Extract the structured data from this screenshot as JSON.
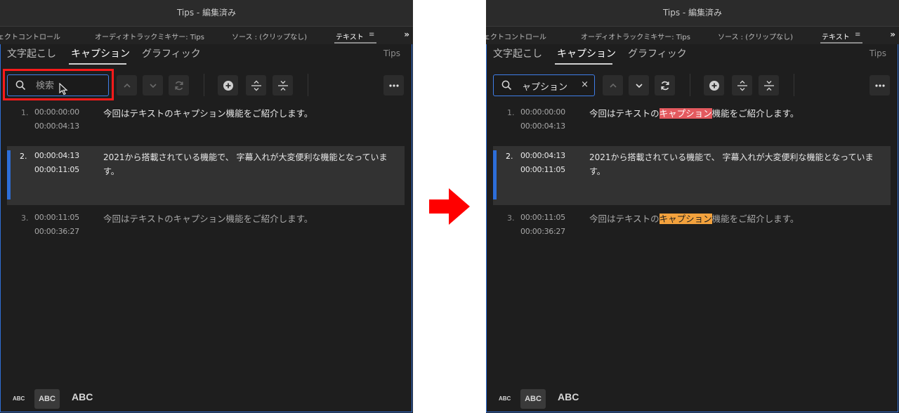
{
  "left": {
    "window_title": "Tips - 編集済み",
    "panel_tabs": {
      "effect_controls": "ェクトコントロール",
      "audio_mixer": "オーディオトラックミキサー: Tips",
      "source": "ソース : (クリップなし)",
      "text": "テキスト",
      "menu_icon": "≡",
      "more_icon": "»"
    },
    "sub_tabs": {
      "transcribe": "文字起こし",
      "captions": "キャプション",
      "graphics": "グラフィック",
      "sequence": "Tips"
    },
    "search": {
      "placeholder": "検索",
      "value": ""
    },
    "captions": [
      {
        "num": "1.",
        "in": "00:00:00:00",
        "out": "00:00:04:13",
        "text": "今回はテキストのキャプション機能をご紹介します。"
      },
      {
        "num": "2.",
        "in": "00:00:04:13",
        "out": "00:00:11:05",
        "text": "2021から搭載されている機能で、 字幕入れが大変便利な機能となっています。"
      },
      {
        "num": "3.",
        "in": "00:00:11:05",
        "out": "00:00:36:27",
        "text": "今回はテキストのキャプション機能をご紹介します。"
      }
    ],
    "text_size": {
      "small": "ABC",
      "medium": "ABC",
      "large": "ABC"
    }
  },
  "right": {
    "window_title": "Tips - 編集済み",
    "panel_tabs": {
      "effect_controls": "ェクトコントロール",
      "audio_mixer": "オーディオトラックミキサー: Tips",
      "source": "ソース : (クリップなし)",
      "text": "テキスト",
      "menu_icon": "≡",
      "more_icon": "»"
    },
    "sub_tabs": {
      "transcribe": "文字起こし",
      "captions": "キャプション",
      "graphics": "グラフィック",
      "sequence": "Tips"
    },
    "search": {
      "value": "ャプション",
      "clear": "×"
    },
    "captions": [
      {
        "num": "1.",
        "in": "00:00:00:00",
        "out": "00:00:04:13",
        "pre": "今回はテキストの",
        "match": "キャプション",
        "post": "機能をご紹介します。"
      },
      {
        "num": "2.",
        "in": "00:00:04:13",
        "out": "00:00:11:05",
        "text": "2021から搭載されている機能で、 字幕入れが大変便利な機能となっています。"
      },
      {
        "num": "3.",
        "in": "00:00:11:05",
        "out": "00:00:36:27",
        "pre": "今回はテキストの",
        "match": "キャプション",
        "post": "機能をご紹介します。"
      }
    ],
    "text_size": {
      "small": "ABC",
      "medium": "ABC",
      "large": "ABC"
    }
  },
  "colors": {
    "accent_blue": "#2f6fd6",
    "search_highlight_red": "#ff1a1a",
    "match_current": "#e45a5f",
    "match_other": "#f3a23d",
    "arrow": "#ff0000"
  }
}
